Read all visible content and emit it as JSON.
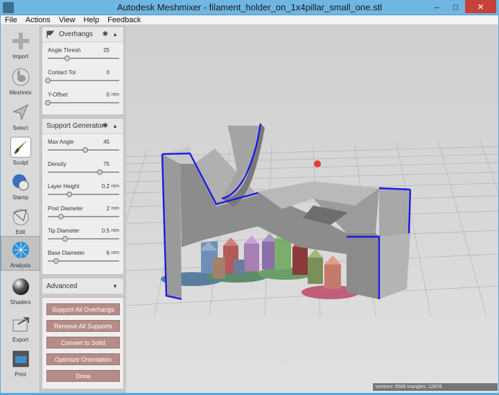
{
  "window": {
    "title": "Autodesk Meshmixer - filament_holder_on_1x4pillar_small_one.stl",
    "minimize": "–",
    "maximize": "□",
    "close": "✕"
  },
  "menu": [
    "File",
    "Actions",
    "View",
    "Help",
    "Feedback"
  ],
  "tools": [
    {
      "label": "Import",
      "icon": "plus-icon"
    },
    {
      "label": "Meshmix",
      "icon": "bunny-icon"
    },
    {
      "label": "Select",
      "icon": "arrow-icon"
    },
    {
      "label": "Sculpt",
      "icon": "brush-icon"
    },
    {
      "label": "Stamp",
      "icon": "stamp-icon"
    },
    {
      "label": "Edit",
      "icon": "edit-icon"
    },
    {
      "label": "Analysis",
      "icon": "analysis-icon"
    },
    {
      "label": "Shaders",
      "icon": "sphere-icon"
    },
    {
      "label": "Export",
      "icon": "export-icon"
    },
    {
      "label": "Print",
      "icon": "printer-icon"
    }
  ],
  "overhangs": {
    "title": "Overhangs",
    "params": [
      {
        "label": "Angle Thresh",
        "value": "25",
        "unit": "",
        "level": 0.27
      },
      {
        "label": "Contact Tol",
        "value": "0",
        "unit": "",
        "level": 0.0
      },
      {
        "label": "Y-Offset",
        "value": "0",
        "unit": "mm",
        "level": 0.0
      }
    ]
  },
  "support": {
    "title": "Support Generator",
    "params": [
      {
        "label": "Max Angle",
        "value": "45",
        "unit": "",
        "level": 0.52
      },
      {
        "label": "Density",
        "value": "75",
        "unit": "",
        "level": 0.73
      },
      {
        "label": "Layer Height",
        "value": "0.2",
        "unit": "mm",
        "level": 0.3
      },
      {
        "label": "Post Diameter",
        "value": "2",
        "unit": "mm",
        "level": 0.18
      },
      {
        "label": "Tip Diameter",
        "value": "0.5",
        "unit": "mm",
        "level": 0.24
      },
      {
        "label": "Base Diameter",
        "value": "6",
        "unit": "mm",
        "level": 0.12
      }
    ]
  },
  "advanced": {
    "title": "Advanced"
  },
  "actions": {
    "support_all": "Support All Overhangs",
    "remove_all": "Remove All Supports",
    "convert": "Convert to Solid",
    "optimize": "Optimize Orientation",
    "done": "Done"
  },
  "status": "vertices: 6506 triangles: 12878",
  "colors": {
    "accent": "#b58c88",
    "titlebar": "#6fb6e3",
    "edge_highlight": "#1a1ae6"
  }
}
